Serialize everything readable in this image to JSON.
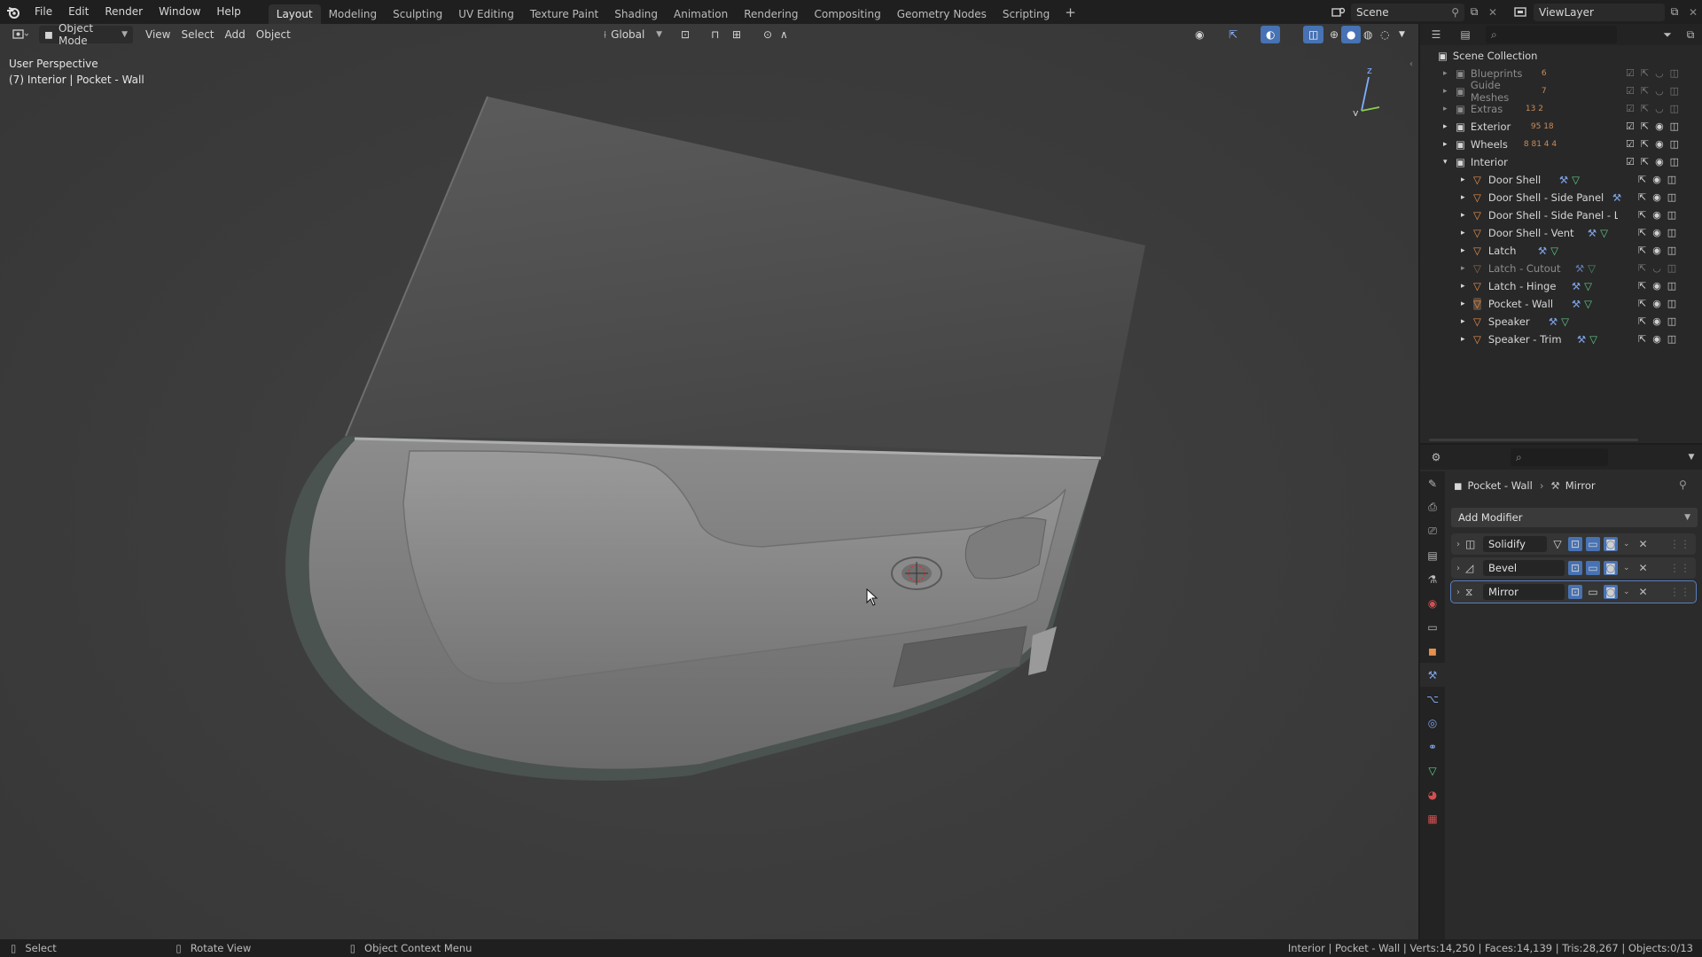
{
  "menu": {
    "items": [
      "File",
      "Edit",
      "Render",
      "Window",
      "Help"
    ]
  },
  "workspaces": {
    "tabs": [
      "Layout",
      "Modeling",
      "Sculpting",
      "UV Editing",
      "Texture Paint",
      "Shading",
      "Animation",
      "Rendering",
      "Compositing",
      "Geometry Nodes",
      "Scripting"
    ],
    "active": "Layout"
  },
  "scene": {
    "name": "Scene"
  },
  "view_layer": {
    "name": "ViewLayer"
  },
  "viewport": {
    "mode": "Object Mode",
    "menus": [
      "View",
      "Select",
      "Add",
      "Object"
    ],
    "transform_orientation": "Global",
    "info_line1": "User Perspective",
    "info_line2": "(7) Interior | Pocket - Wall"
  },
  "outliner": {
    "root": "Scene Collection",
    "collections": [
      {
        "name": "Blueprints",
        "badge": "6"
      },
      {
        "name": "Guide Meshes",
        "badge": "7"
      },
      {
        "name": "Extras",
        "badge": "13  2"
      },
      {
        "name": "Exterior",
        "badge": "95  18"
      },
      {
        "name": "Wheels",
        "badge": "8  81  4  4"
      },
      {
        "name": "Interior",
        "badge": ""
      }
    ],
    "interior_children": [
      "Door Shell",
      "Door Shell - Side Panel",
      "Door Shell - Side Panel - Light",
      "Door Shell - Vent",
      "Latch",
      "Latch - Cutout",
      "Latch - Hinge",
      "Pocket - Wall",
      "Speaker",
      "Speaker - Trim"
    ]
  },
  "properties": {
    "object": "Pocket - Wall",
    "modifier_breadcrumb": "Mirror",
    "add_modifier_label": "Add Modifier",
    "modifiers": [
      "Solidify",
      "Bevel",
      "Mirror"
    ]
  },
  "status": {
    "select": "Select",
    "rotate": "Rotate View",
    "context": "Object Context Menu",
    "stats": "Interior | Pocket - Wall | Verts:14,250 | Faces:14,139 | Tris:28,267 | Objects:0/13"
  },
  "colors": {
    "accent": "#4772b3",
    "mesh_icon": "#e8914e",
    "modifier_icon": "#7fa4e8",
    "data_icon": "#62c98a"
  }
}
